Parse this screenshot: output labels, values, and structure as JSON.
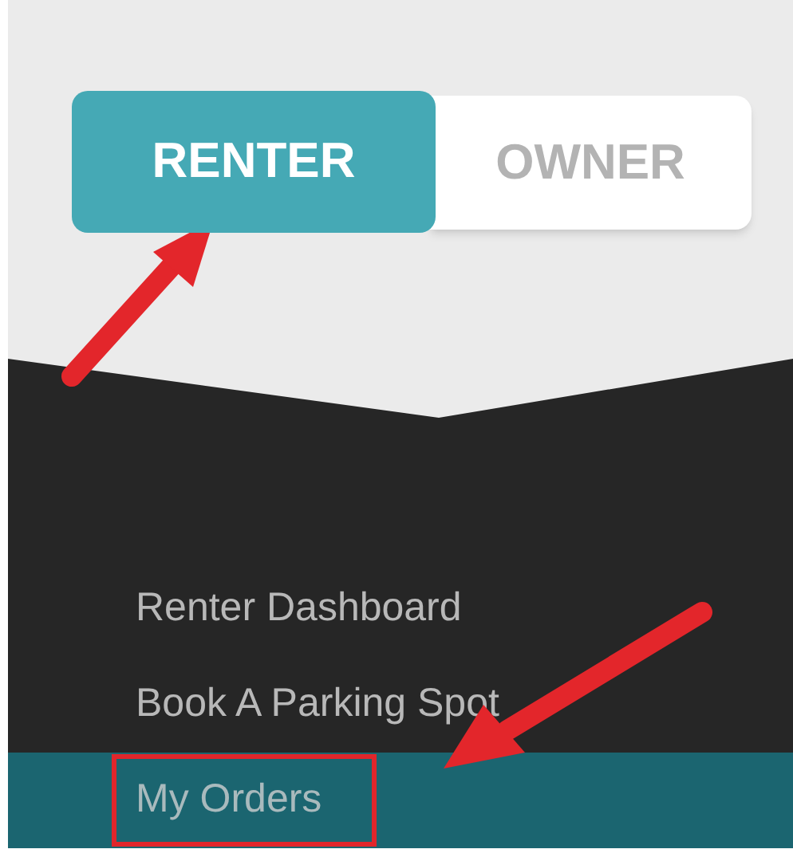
{
  "role_toggle": [
    {
      "label": "RENTER",
      "selected": true
    },
    {
      "label": "OWNER",
      "selected": false
    }
  ],
  "menu": [
    {
      "label": "Renter Dashboard",
      "selected": false
    },
    {
      "label": "Book A Parking Spot",
      "selected": false
    },
    {
      "label": "My Orders",
      "selected": true
    }
  ]
}
